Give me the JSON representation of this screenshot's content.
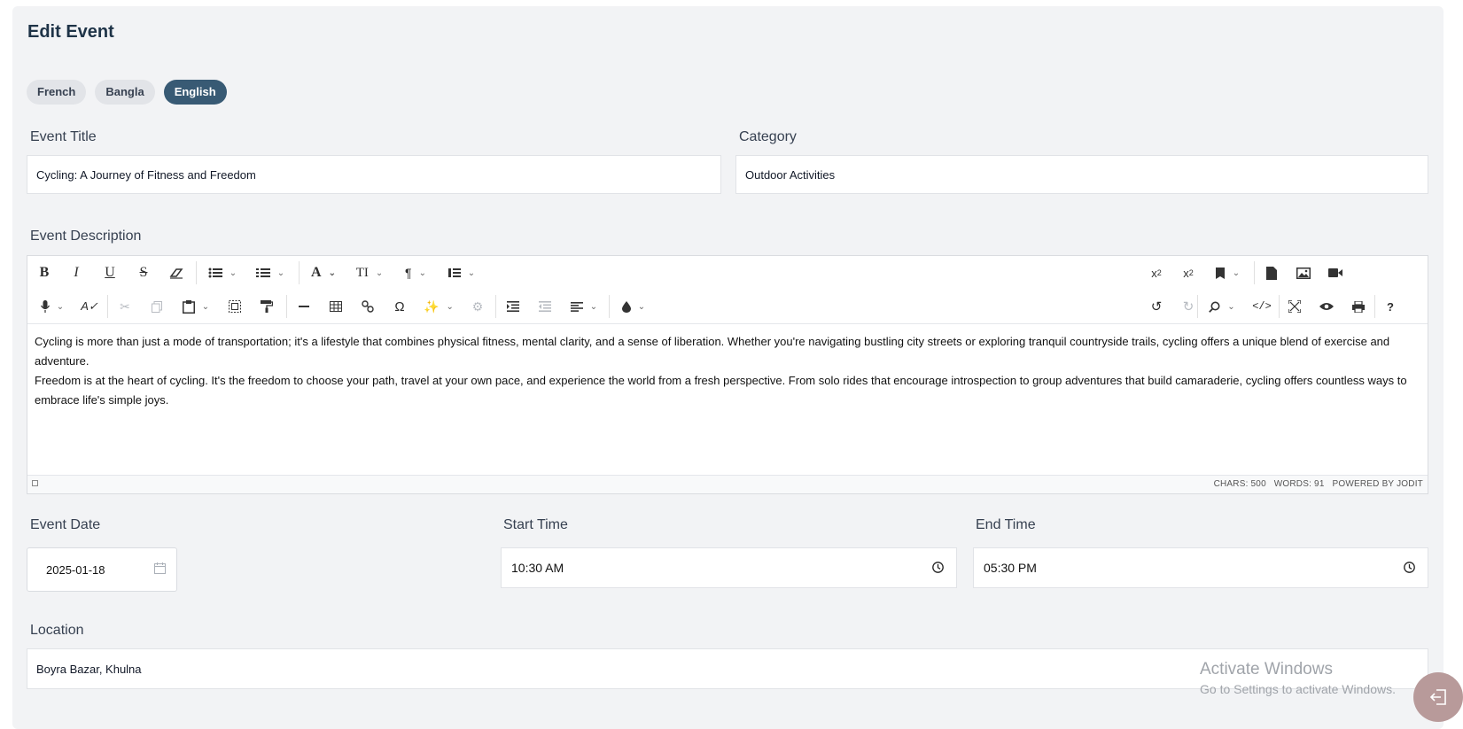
{
  "page": {
    "title": "Edit Event"
  },
  "languages": [
    {
      "label": "French"
    },
    {
      "label": "Bangla"
    },
    {
      "label": "English",
      "active": true
    }
  ],
  "fields": {
    "event_title": {
      "label": "Event Title",
      "value": "Cycling: A Journey of Fitness and Freedom"
    },
    "category": {
      "label": "Category",
      "value": "Outdoor Activities"
    },
    "description": {
      "label": "Event Description"
    },
    "event_date": {
      "label": "Event Date",
      "value": "2025-01-18"
    },
    "start_time": {
      "label": "Start Time",
      "value": "10:30 AM"
    },
    "end_time": {
      "label": "End Time",
      "value": "05:30 PM"
    },
    "location": {
      "label": "Location",
      "value": "Boyra Bazar, Khulna"
    }
  },
  "editor": {
    "paragraphs": [
      "Cycling is more than just a mode of transportation; it's a lifestyle that combines physical fitness, mental clarity, and a sense of liberation. Whether you're navigating bustling city streets or exploring tranquil countryside trails, cycling offers a unique blend of exercise and adventure.",
      "Freedom is at the heart of cycling. It's the freedom to choose your path, travel at your own pace, and experience the world from a fresh perspective. From solo rides that encourage introspection to group adventures that build camaraderie, cycling offers countless ways to embrace life's simple joys."
    ],
    "status": {
      "chars": "CHARS: 500",
      "words": "WORDS: 91",
      "powered": "POWERED BY JODIT"
    },
    "toolbar_icons": [
      "bold-icon",
      "italic-icon",
      "underline-icon",
      "strikethrough-icon",
      "eraser-icon",
      "bullet-list-icon",
      "numbered-list-icon",
      "font-icon",
      "font-size-icon",
      "paragraph-icon",
      "line-height-icon",
      "superscript-icon",
      "subscript-icon",
      "source-file-icon",
      "file-icon",
      "image-icon",
      "video-icon",
      "microphone-icon",
      "spellcheck-icon",
      "cut-icon",
      "copy-icon",
      "paste-icon",
      "select-all-icon",
      "format-painter-icon",
      "horizontal-rule-icon",
      "table-icon",
      "link-icon",
      "omega-icon",
      "ai-icon",
      "ai-assistant-icon",
      "indent-icon",
      "outdent-icon",
      "align-icon",
      "brush-icon",
      "undo-icon",
      "redo-icon",
      "search-icon",
      "code-icon",
      "fullscreen-icon",
      "preview-icon",
      "print-icon",
      "help-icon"
    ]
  },
  "watermark": {
    "line1": "Activate Windows",
    "line2": "Go to Settings to activate Windows."
  },
  "colors": {
    "accent": "#385a74",
    "card_bg": "#f2f3f5",
    "fab": "#b89a9a"
  }
}
